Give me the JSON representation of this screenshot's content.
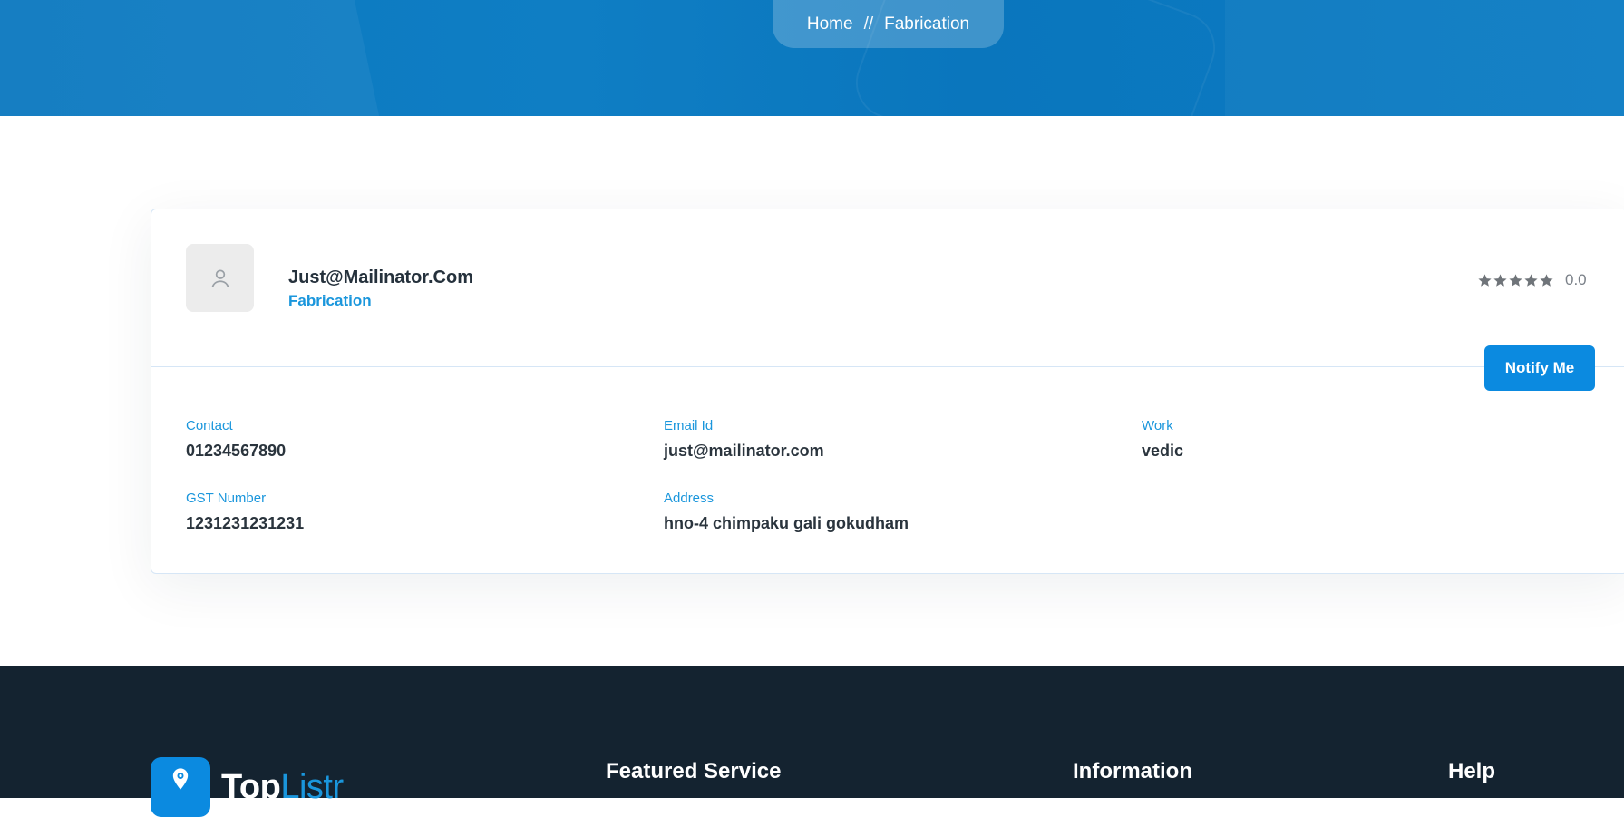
{
  "breadcrumb": {
    "home": "Home",
    "separator": "//",
    "current": "Fabrication"
  },
  "listing": {
    "name": "Just@Mailinator.Com",
    "category": "Fabrication",
    "rating_value": "0.0",
    "rating_stars": 5,
    "notify_button": "Notify Me",
    "avatar_icon": "user-icon"
  },
  "details": {
    "contact": {
      "label": "Contact",
      "value": "01234567890"
    },
    "email": {
      "label": "Email Id",
      "value": "just@mailinator.com"
    },
    "work": {
      "label": "Work",
      "value": "vedic"
    },
    "gst": {
      "label": "GST Number",
      "value": "1231231231231"
    },
    "address": {
      "label": "Address",
      "value": "hno-4 chimpaku gali gokudham"
    }
  },
  "footer": {
    "logo_part1": "Top",
    "logo_part2": "Listr",
    "logo_icon": "map-pin-icon",
    "col1": "Featured Service",
    "col2": "Information",
    "col3": "Help"
  },
  "colors": {
    "accent": "#0b8ae0",
    "label_blue": "#1a96dc",
    "hero": "#0a78bf",
    "footer": "#142330"
  }
}
